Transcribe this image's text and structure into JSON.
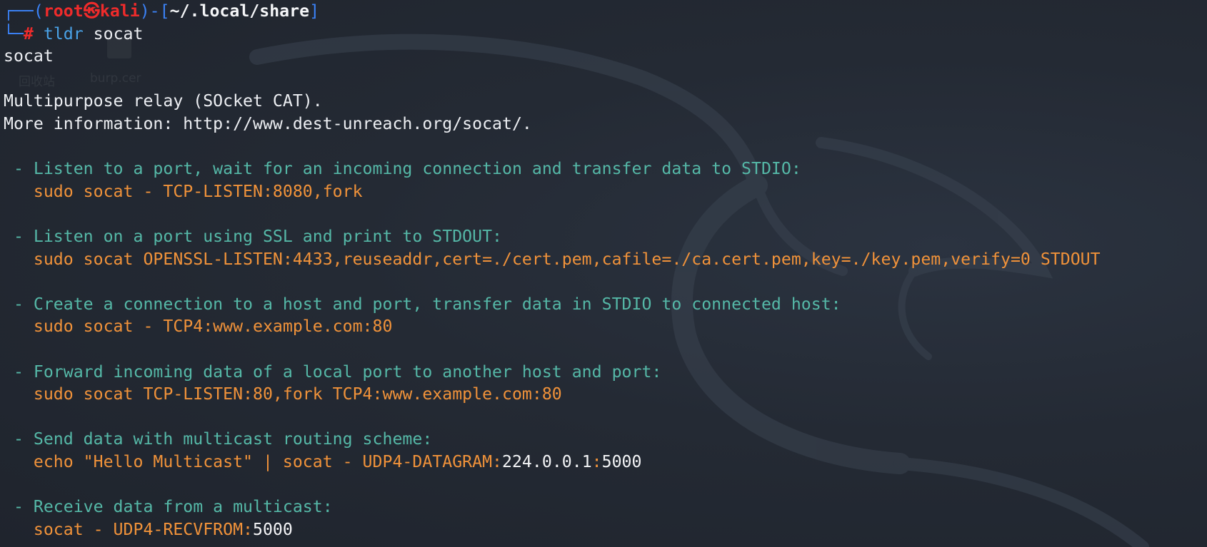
{
  "desktop": {
    "icon1_label": "回收站",
    "icon2_label": "burp.cer"
  },
  "prompt": {
    "corner_top": "┌──(",
    "user": "root",
    "at_symbol": "㉿",
    "host": "kali",
    "sep": ")-[",
    "cwd": "~/.local/share",
    "close": "]",
    "corner_bottom": "└─",
    "hash": "#",
    "command": "tldr",
    "argument": "socat"
  },
  "output": {
    "title": "socat",
    "description": "Multipurpose relay (SOcket CAT).",
    "more_info": "More information: http://www.dest-unreach.org/socat/.",
    "examples": [
      {
        "desc": " - Listen to a port, wait for an incoming connection and transfer data to STDIO:",
        "code": "   sudo socat - TCP-LISTEN:8080,fork"
      },
      {
        "desc": " - Listen on a port using SSL and print to STDOUT:",
        "code": "   sudo socat OPENSSL-LISTEN:4433,reuseaddr,cert=./cert.pem,cafile=./ca.cert.pem,key=./key.pem,verify=0 STDOUT"
      },
      {
        "desc": " - Create a connection to a host and port, transfer data in STDIO to connected host:",
        "code": "   sudo socat - TCP4:www.example.com:80"
      },
      {
        "desc": " - Forward incoming data of a local port to another host and port:",
        "code": "   sudo socat TCP-LISTEN:80,fork TCP4:www.example.com:80"
      },
      {
        "desc": " - Send data with multicast routing scheme:",
        "code_a": "   echo \"Hello Multicast\" | socat - UDP4-DATAGRAM:",
        "val_a": "224.0.0.1",
        "code_b": ":",
        "val_b": "5000"
      },
      {
        "desc": " - Receive data from a multicast:",
        "code_a": "   socat - UDP4-RECVFROM:",
        "val_a": "5000"
      }
    ]
  },
  "colors": {
    "background": "#242a34",
    "prompt_frame": "#3b82f6",
    "prompt_user": "#ef2b2b",
    "command": "#4aa3e8",
    "description": "#55b8a7",
    "code": "#f0923a"
  }
}
